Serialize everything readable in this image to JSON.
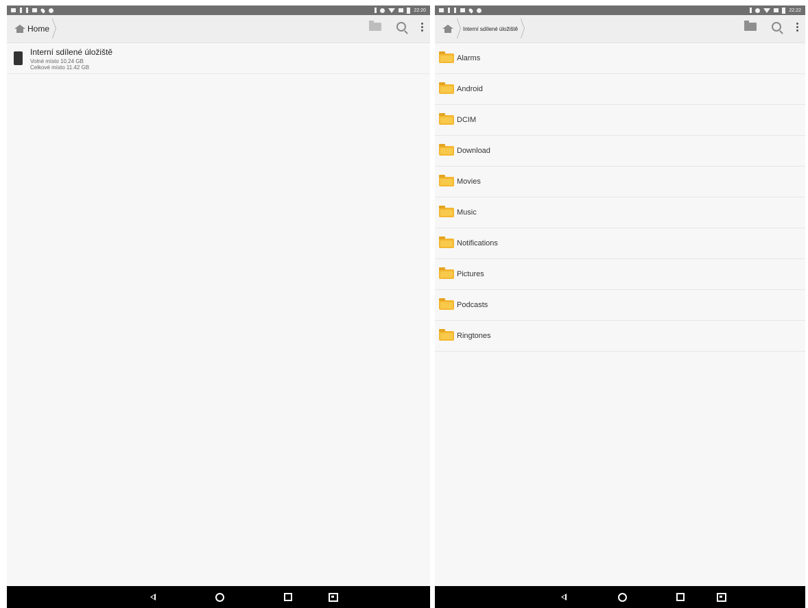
{
  "left_screen": {
    "status_time": "22:20",
    "breadcrumb": {
      "home_label": "Home"
    },
    "storage": {
      "title": "Interní sdílené úložiště",
      "free_space": "Volné místo 10.24 GB",
      "total_space": "Celkové místo 11.42 GB"
    }
  },
  "right_screen": {
    "status_time": "22:22",
    "breadcrumb": {
      "current": "Interní sdílené úložiště"
    },
    "folders": [
      "Alarms",
      "Android",
      "DCIM",
      "Download",
      "Movies",
      "Music",
      "Notifications",
      "Pictures",
      "Podcasts",
      "Ringtones"
    ]
  },
  "icons": {
    "toolbar": [
      "home-icon",
      "new-folder-icon",
      "search-icon",
      "more-vert-icon"
    ],
    "navbar": [
      "back-icon",
      "home-button-icon",
      "recents-icon",
      "screenshot-icon"
    ],
    "list": [
      "device-icon",
      "folder-icon"
    ]
  },
  "colors": {
    "status_bar": "#6f6f6f",
    "toolbar": "#eeeeee",
    "background": "#f7f7f7",
    "folder": "#f4b731",
    "nav_bar": "#000000"
  }
}
